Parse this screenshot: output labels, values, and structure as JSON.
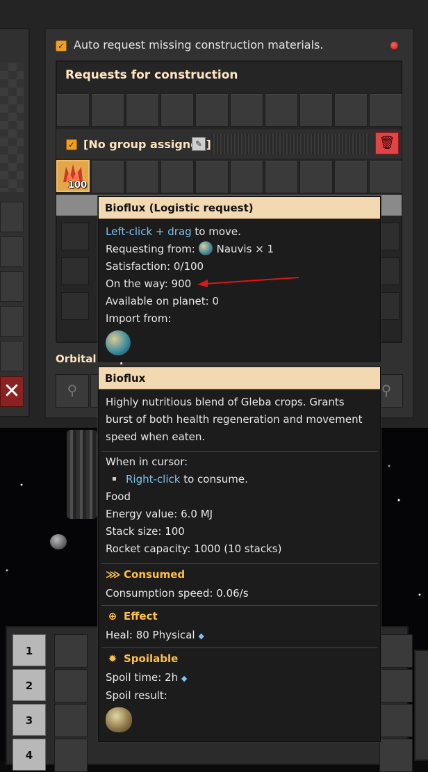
{
  "main_panel": {
    "auto_request_label": "Auto request missing construction materials.",
    "requests_title": "Requests for construction",
    "group_label": "[No group assigned]",
    "item_count": "100",
    "orbital_label": "Orbital drop slots"
  },
  "tooltip_request": {
    "title": "Bioflux (Logistic request)",
    "move_action": "Left-click + drag",
    "move_suffix": " to move.",
    "requesting_from_label": "Requesting from:",
    "requesting_from_value": "Nauvis × 1",
    "satisfaction_label": "Satisfaction:",
    "satisfaction_value": "0/100",
    "on_the_way_label": "On the way:",
    "on_the_way_value": "900",
    "available_label": "Available on planet:",
    "available_value": "0",
    "import_label": "Import from:"
  },
  "tooltip_item": {
    "title": "Bioflux",
    "description": "Highly nutritious blend of Gleba crops. Grants burst of both health regeneration and movement speed when eaten.",
    "cursor_label": "When in cursor:",
    "cursor_action": "Right-click",
    "cursor_suffix": " to consume.",
    "category": "Food",
    "energy_label": "Energy value:",
    "energy_value": "6.0 MJ",
    "stack_label": "Stack size:",
    "stack_value": "100",
    "rocket_label": "Rocket capacity:",
    "rocket_value": "1000 (10 stacks)",
    "consumed_title": "Consumed",
    "consumption_label": "Consumption speed:",
    "consumption_value": "0.06/s",
    "effect_title": "Effect",
    "heal_label": "Heal:",
    "heal_value": "80 Physical",
    "spoilable_title": "Spoilable",
    "spoil_time_label": "Spoil time:",
    "spoil_time_value": "2h",
    "spoil_result_label": "Spoil result:"
  },
  "quickbar": {
    "rows": [
      "1",
      "2",
      "3",
      "4"
    ]
  },
  "colors": {
    "accent_orange": "#ffc04a",
    "highlight_blue": "#7ec3f0",
    "tooltip_header": "#f2d9b1",
    "delete_red": "#e04545"
  }
}
